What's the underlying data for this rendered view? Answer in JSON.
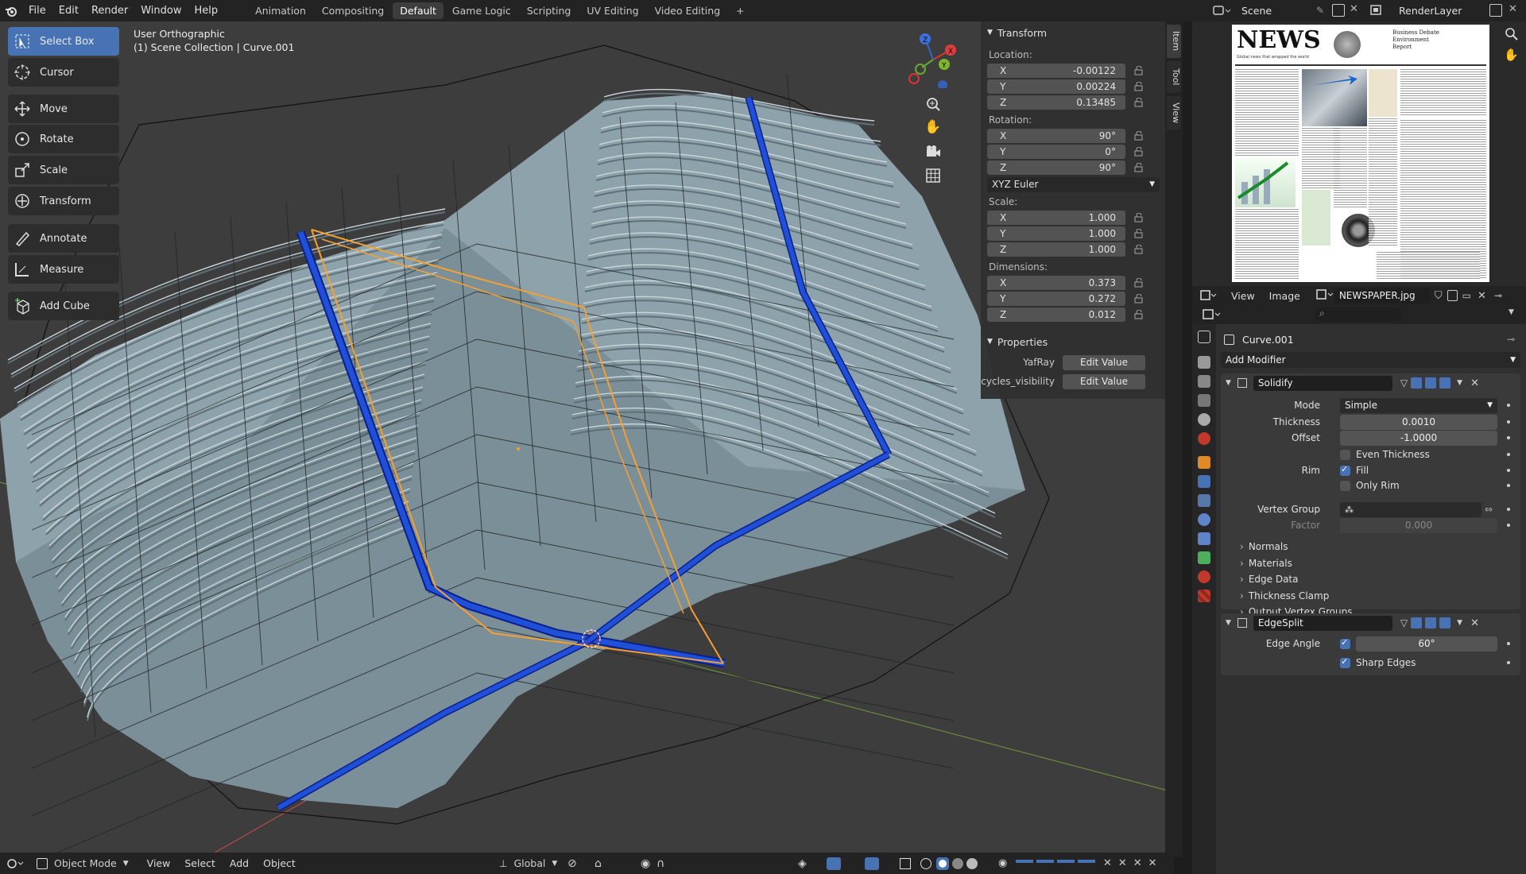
{
  "menu": [
    "File",
    "Edit",
    "Render",
    "Window",
    "Help"
  ],
  "workspaces": [
    "Animation",
    "Compositing",
    "Default",
    "Game Logic",
    "Scripting",
    "UV Editing",
    "Video Editing"
  ],
  "active_workspace": "Default",
  "add_workspace": "+",
  "scene_name": "Scene",
  "render_layer": "RenderLayer",
  "toolbar": {
    "select_box": "Select Box",
    "cursor": "Cursor",
    "move": "Move",
    "rotate": "Rotate",
    "scale": "Scale",
    "transform": "Transform",
    "annotate": "Annotate",
    "measure": "Measure",
    "add_cube": "Add Cube"
  },
  "viewport": {
    "view_name": "User Orthographic",
    "collection": "(1) Scene Collection | Curve.001"
  },
  "npanel": {
    "transform_title": "Transform",
    "location_label": "Location:",
    "location": [
      [
        "X",
        "-0.00122"
      ],
      [
        "Y",
        "0.00224"
      ],
      [
        "Z",
        "0.13485"
      ]
    ],
    "rotation_label": "Rotation:",
    "rotation": [
      [
        "X",
        "90°"
      ],
      [
        "Y",
        "0°"
      ],
      [
        "Z",
        "90°"
      ]
    ],
    "rotation_mode": "XYZ Euler",
    "scale_label": "Scale:",
    "scale": [
      [
        "X",
        "1.000"
      ],
      [
        "Y",
        "1.000"
      ],
      [
        "Z",
        "1.000"
      ]
    ],
    "dimensions_label": "Dimensions:",
    "dimensions": [
      [
        "X",
        "0.373"
      ],
      [
        "Y",
        "0.272"
      ],
      [
        "Z",
        "0.012"
      ]
    ],
    "properties_title": "Properties",
    "prop_yafray": "YafRay",
    "prop_cycles": "cycles_visibility",
    "edit_value": "Edit Value",
    "tabs": [
      "Item",
      "Tool",
      "View"
    ]
  },
  "bottombar": {
    "mode": "Object Mode",
    "view": "View",
    "select": "Select",
    "add": "Add",
    "object": "Object",
    "orientation": "Global"
  },
  "image_editor": {
    "view": "View",
    "image": "Image",
    "filename": "NEWSPAPER.jpg",
    "newspaper_title": "NEWS",
    "newspaper_sub": "Global news that wrapped the world",
    "newspaper_headline": "Business Debate Environment Report"
  },
  "properties": {
    "object_name": "Curve.001",
    "add_modifier": "Add Modifier",
    "solidify": {
      "name": "Solidify",
      "mode_label": "Mode",
      "mode": "Simple",
      "thickness_label": "Thickness",
      "thickness": "0.0010",
      "offset_label": "Offset",
      "offset": "-1.0000",
      "even_thickness": "Even Thickness",
      "rim_label": "Rim",
      "fill": "Fill",
      "only_rim": "Only Rim",
      "vertex_group_label": "Vertex Group",
      "factor_label": "Factor",
      "factor": "0.000",
      "subpanels": [
        "Normals",
        "Materials",
        "Edge Data",
        "Thickness Clamp",
        "Output Vertex Groups"
      ]
    },
    "edgesplit": {
      "name": "EdgeSplit",
      "edge_angle_label": "Edge Angle",
      "edge_angle": "60°",
      "sharp_edges": "Sharp Edges"
    }
  },
  "colors": {
    "accent": "#4772b3",
    "viewport_bg": "#3d3d3d",
    "mesh": "#8fa3ad",
    "selection": "#f5a030",
    "edge_blue": "#1f4fd6"
  }
}
